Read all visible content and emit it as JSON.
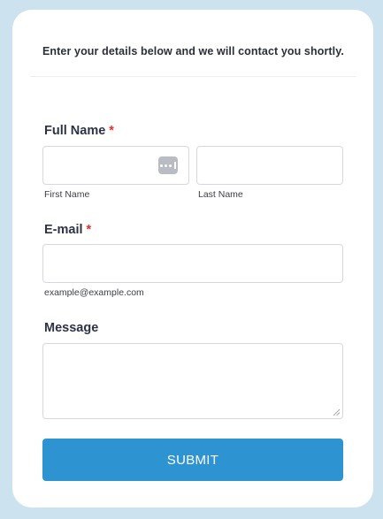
{
  "intro_text": "Enter your details below and we will contact you shortly.",
  "full_name": {
    "label": "Full Name",
    "required_mark": "*",
    "first": {
      "value": "",
      "sublabel": "First Name"
    },
    "last": {
      "value": "",
      "sublabel": "Last Name"
    }
  },
  "email": {
    "label": "E-mail",
    "required_mark": "*",
    "value": "",
    "sublabel": "example@example.com"
  },
  "message": {
    "label": "Message",
    "value": ""
  },
  "submit_label": "SUBMIT",
  "colors": {
    "page_background": "#cce2ef",
    "accent": "#2e93d1",
    "required": "#e0312b"
  },
  "icons": {
    "first_name_field": "password-manager-icon",
    "message_field": "resize-grip-icon"
  }
}
